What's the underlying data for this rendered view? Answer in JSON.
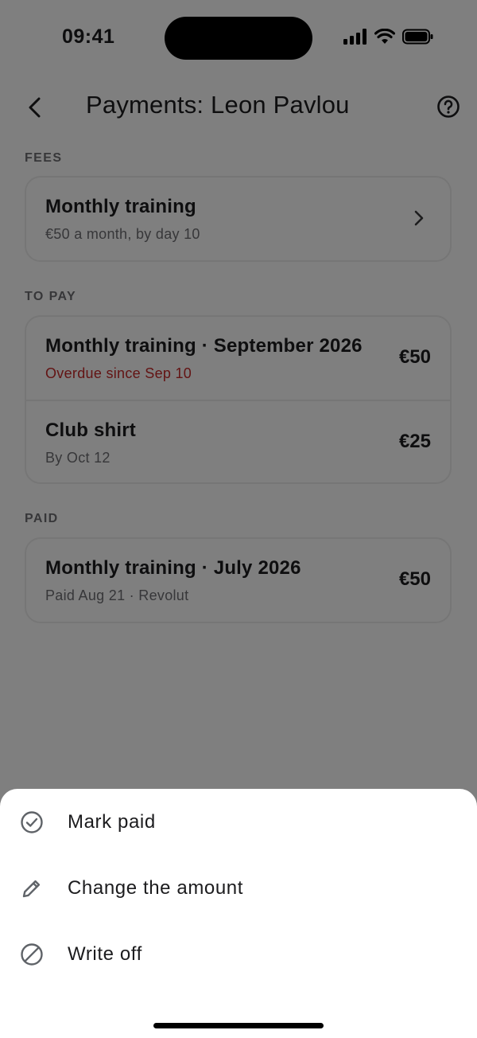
{
  "status_bar": {
    "time": "09:41",
    "icons": [
      "cellular-signal-icon",
      "wifi-icon",
      "battery-icon"
    ]
  },
  "header": {
    "title": "Payments: Leon Pavlou",
    "back_icon": "chevron-left-icon",
    "help_icon": "question-circle-icon"
  },
  "sections": {
    "fees": {
      "label": "FEES",
      "items": [
        {
          "title": "Monthly training",
          "subtitle": "€50 a month, by day 10",
          "icon": "chevron-right-icon"
        }
      ]
    },
    "to_pay": {
      "label": "TO PAY",
      "items": [
        {
          "title": "Monthly training · September 2026",
          "subtitle": "Overdue since Sep 10",
          "amount": "€50",
          "status": "overdue"
        },
        {
          "title": "Club shirt",
          "subtitle": "By Oct 12",
          "amount": "€25"
        }
      ]
    },
    "paid": {
      "label": "PAID",
      "items": [
        {
          "title": "Monthly training · July 2026",
          "subtitle": "Paid Aug 21 · Revolut",
          "amount": "€50"
        }
      ]
    }
  },
  "action_sheet": {
    "items": [
      {
        "label": "Mark paid",
        "icon": "check-circle-icon"
      },
      {
        "label": "Change the amount",
        "icon": "pencil-icon"
      },
      {
        "label": "Write off",
        "icon": "block-icon"
      }
    ]
  },
  "colors": {
    "overdue": "#c62828",
    "text_primary": "#1c1c1e",
    "text_secondary": "#6e6e73",
    "scrim": "rgba(0,0,0,0.5)"
  }
}
